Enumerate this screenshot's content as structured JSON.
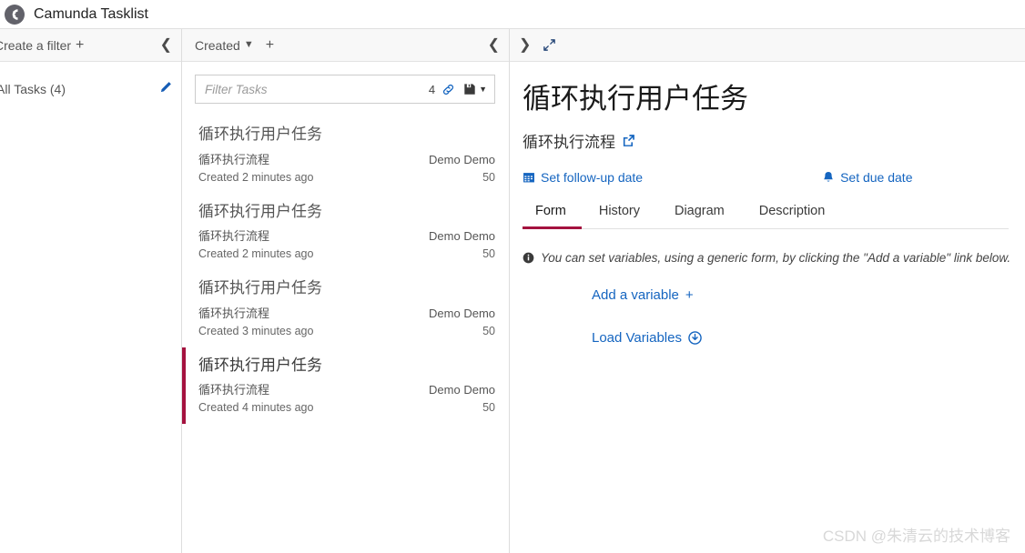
{
  "app": {
    "title": "Camunda Tasklist",
    "logo_icon": "camunda-logo-icon"
  },
  "filter_pane": {
    "create_filter_label": "Create a filter",
    "create_filter_plus": "+",
    "collapse_icon": "chevron-left-icon",
    "filters": [
      {
        "label": "All Tasks (4)",
        "edit_icon": "pencil-icon"
      }
    ]
  },
  "task_pane": {
    "sort_label": "Created",
    "sort_caret_icon": "chevron-down-icon",
    "add_sort_plus": "+",
    "collapse_icon": "chevron-left-icon",
    "search": {
      "placeholder": "Filter Tasks",
      "value": "",
      "result_count": "4",
      "link_icon": "link-icon",
      "save_icon": "floppy-disk-icon",
      "save_caret_icon": "caret-down-icon"
    },
    "tasks": [
      {
        "title": "循环执行用户任务",
        "process": "循环执行流程",
        "assignee": "Demo Demo",
        "created": "Created 2 minutes ago",
        "priority": "50",
        "selected": false
      },
      {
        "title": "循环执行用户任务",
        "process": "循环执行流程",
        "assignee": "Demo Demo",
        "created": "Created 2 minutes ago",
        "priority": "50",
        "selected": false
      },
      {
        "title": "循环执行用户任务",
        "process": "循环执行流程",
        "assignee": "Demo Demo",
        "created": "Created 3 minutes ago",
        "priority": "50",
        "selected": false
      },
      {
        "title": "循环执行用户任务",
        "process": "循环执行流程",
        "assignee": "Demo Demo",
        "created": "Created 4 minutes ago",
        "priority": "50",
        "selected": true
      }
    ]
  },
  "detail_pane": {
    "expand_list_icon": "chevron-right-icon",
    "maximize_icon": "expand-arrows-icon",
    "task_name": "循环执行用户任务",
    "process_name": "循环执行流程",
    "process_link_icon": "external-link-icon",
    "follow_up": {
      "label": "Set follow-up date",
      "icon": "calendar-icon"
    },
    "due_date": {
      "label": "Set due date",
      "icon": "bell-icon"
    },
    "tabs": [
      {
        "label": "Form",
        "active": true
      },
      {
        "label": "History",
        "active": false
      },
      {
        "label": "Diagram",
        "active": false
      },
      {
        "label": "Description",
        "active": false
      }
    ],
    "form": {
      "hint_icon": "info-circle-icon",
      "hint": "You can set variables, using a generic form, by clicking the \"Add a variable\" link below.",
      "add_variable_label": "Add a variable",
      "add_variable_plus": "+",
      "load_variables_label": "Load Variables",
      "load_variables_icon": "download-circle-icon"
    }
  },
  "watermark": "CSDN @朱清云的技术博客",
  "colors": {
    "accent_red": "#a4123f",
    "link_blue": "#1565c0",
    "logo_gray": "#62626a",
    "header_bg": "#f8f8f8"
  }
}
